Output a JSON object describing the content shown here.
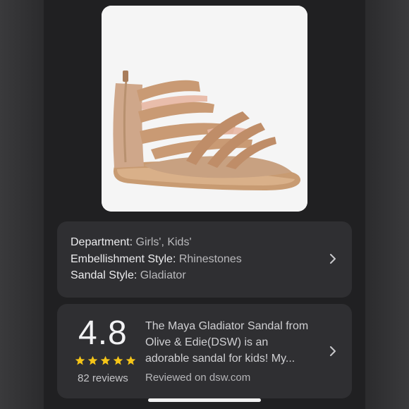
{
  "product": {
    "image_alt": "Rose gold glitter gladiator sandal"
  },
  "attributes": {
    "items": [
      {
        "key": "Department:",
        "value": "Girls', Kids'"
      },
      {
        "key": "Embellishment Style:",
        "value": "Rhinestones"
      },
      {
        "key": "Sandal Style:",
        "value": "Gladiator"
      }
    ]
  },
  "review": {
    "rating": "4.8",
    "stars": 5,
    "count": "82 reviews",
    "summary_line1": "The Maya Gladiator Sandal from",
    "summary_line2": "Olive & Edie(DSW) is an",
    "summary_line3": "adorable sandal for kids! My...",
    "source": "Reviewed on dsw.com"
  },
  "colors": {
    "star": "#f5c518",
    "card": "#2f2f32",
    "background": "#202022"
  },
  "icons": {
    "attributes_chevron": "chevron-right-icon",
    "review_chevron": "chevron-right-icon",
    "star": "star-icon"
  }
}
